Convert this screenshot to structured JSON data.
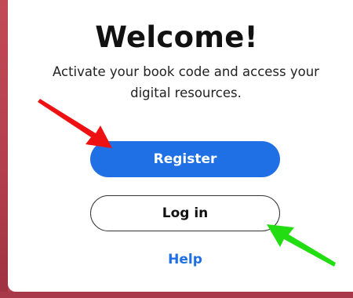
{
  "dialog": {
    "title": "Welcome!",
    "subtitle": "Activate your book code and access your digital resources."
  },
  "actions": {
    "register_label": "Register",
    "login_label": "Log in",
    "help_label": "Help"
  },
  "annotations": {
    "register_arrow_color": "#ee1111",
    "login_arrow_color": "#22dd11"
  },
  "colors": {
    "background": "#b8404e",
    "primary": "#1f6fe5",
    "card": "#ffffff"
  }
}
